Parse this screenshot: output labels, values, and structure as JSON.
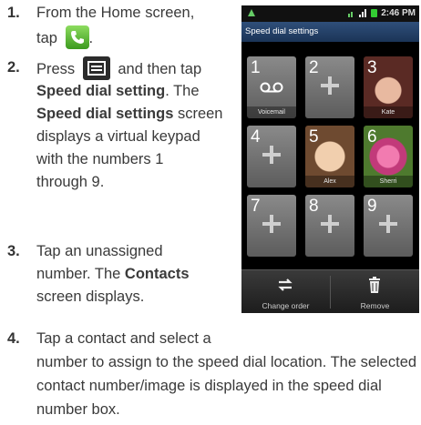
{
  "steps": [
    {
      "num": "1.",
      "line1": "From the Home screen,",
      "line2_pre": "tap",
      "line2_post": "."
    },
    {
      "num": "2.",
      "line1_pre": "Press",
      "line1_post": "and then tap",
      "line2_bold": "Speed dial setting",
      "line2_post": ". The",
      "line3_bold": "Speed dial settings",
      "line3_post": " screen",
      "line4": "displays a virtual keypad",
      "line5": "with the numbers 1",
      "line6": "through 9."
    },
    {
      "num": "3.",
      "line1": "Tap an unassigned",
      "line2_pre": "number. The ",
      "line2_bold": "Contacts",
      "line3": "screen displays."
    },
    {
      "num": "4.",
      "line1": "Tap a contact and select a",
      "line2": "number to assign to the speed dial location. The selected",
      "line3": "contact number/image is displayed in the speed dial",
      "line4": "number box."
    }
  ],
  "phone": {
    "time": "2:46 PM",
    "title": "Speed dial settings",
    "keys": [
      {
        "num": "1",
        "label": "Voicemail",
        "type": "voicemail"
      },
      {
        "num": "2",
        "label": "",
        "type": "empty"
      },
      {
        "num": "3",
        "label": "Kate",
        "type": "photo",
        "color": "#7a2f2a"
      },
      {
        "num": "4",
        "label": "",
        "type": "empty"
      },
      {
        "num": "5",
        "label": "Alex",
        "type": "photo",
        "color": "#8a6a4a"
      },
      {
        "num": "6",
        "label": "Sherri",
        "type": "photo",
        "color": "#c2457a"
      },
      {
        "num": "7",
        "label": "",
        "type": "empty"
      },
      {
        "num": "8",
        "label": "",
        "type": "empty"
      },
      {
        "num": "9",
        "label": "",
        "type": "empty"
      }
    ],
    "bottom": {
      "change_order": "Change order",
      "remove": "Remove"
    }
  }
}
